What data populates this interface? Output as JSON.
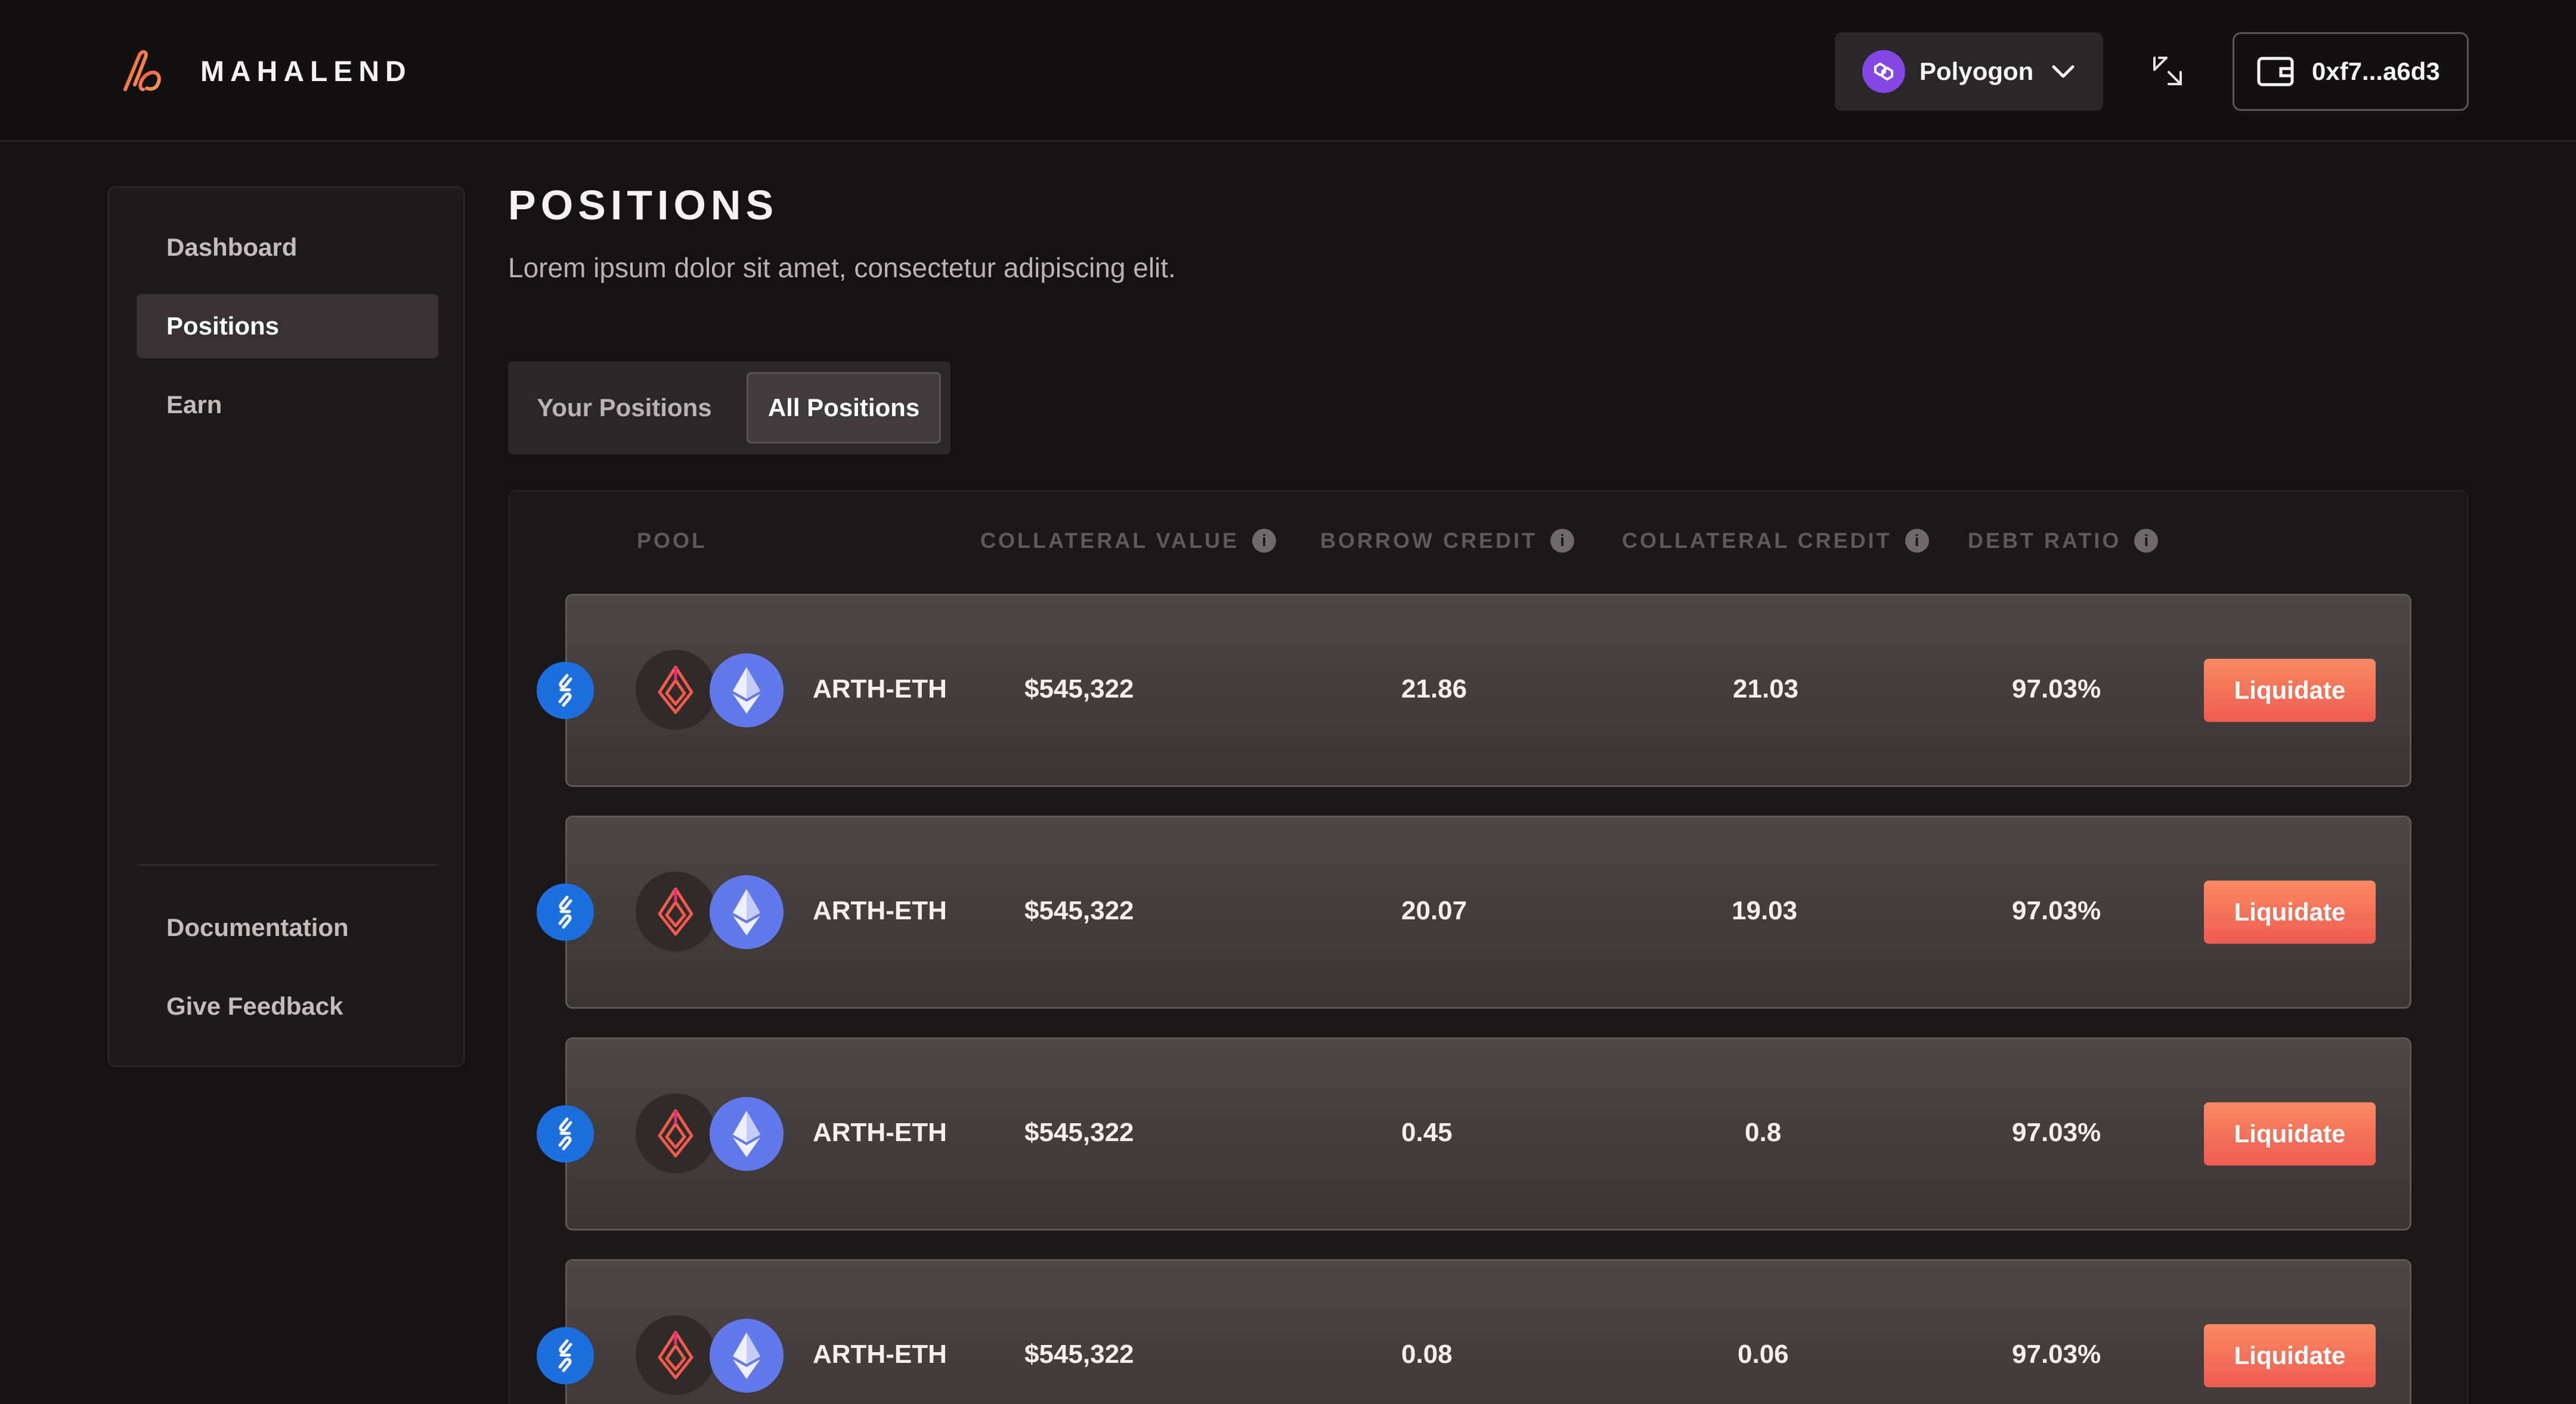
{
  "brand": {
    "name": "MAHALEND"
  },
  "header": {
    "network_label": "Polyogon",
    "wallet_label": "0xf7...a6d3"
  },
  "sidebar": {
    "items": [
      {
        "label": "Dashboard"
      },
      {
        "label": "Positions",
        "active": true
      },
      {
        "label": "Earn"
      }
    ],
    "footer_items": [
      {
        "label": "Documentation"
      },
      {
        "label": "Give Feedback"
      }
    ]
  },
  "page": {
    "title": "POSITIONS",
    "subtitle": "Lorem ipsum dolor sit amet, consectetur adipiscing elit.",
    "tabs": [
      {
        "label": "Your Positions"
      },
      {
        "label": "All Positions",
        "active": true
      }
    ]
  },
  "table": {
    "headers": {
      "pool": "POOL",
      "collateral_value": "COLLATERAL VALUE",
      "borrow_credit": "BORROW CREDIT",
      "collateral_credit": "COLLATERAL CREDIT",
      "debt_ratio": "DEBT RATIO"
    },
    "info_glyph": "i",
    "rows": [
      {
        "pool": "ARTH-ETH",
        "collateral_value": "$545,322",
        "borrow_credit": "21.86",
        "collateral_credit": "21.03",
        "debt_ratio": "97.03%",
        "action": "Liquidate"
      },
      {
        "pool": "ARTH-ETH",
        "collateral_value": "$545,322",
        "borrow_credit": "20.07",
        "collateral_credit": "19.03",
        "debt_ratio": "97.03%",
        "action": "Liquidate"
      },
      {
        "pool": "ARTH-ETH",
        "collateral_value": "$545,322",
        "borrow_credit": "0.45",
        "collateral_credit": "0.8",
        "debt_ratio": "97.03%",
        "action": "Liquidate"
      },
      {
        "pool": "ARTH-ETH",
        "collateral_value": "$545,322",
        "borrow_credit": "0.08",
        "collateral_credit": "0.06",
        "debt_ratio": "97.03%",
        "action": "Liquidate"
      }
    ]
  },
  "colors": {
    "accent": "#ef5b50",
    "chain_badge": "#1d6fe0",
    "eth": "#6279ec",
    "polygon": "#8247e5"
  },
  "icons": {
    "brand": "mahalend-logo",
    "network": "polygon-icon",
    "chevron": "chevron-down-icon",
    "swap": "collapse-arrows-icon",
    "wallet": "wallet-icon",
    "chain": "chain-link-icon",
    "token_a": "arth-icon",
    "token_b": "eth-icon",
    "info": "info-icon"
  }
}
